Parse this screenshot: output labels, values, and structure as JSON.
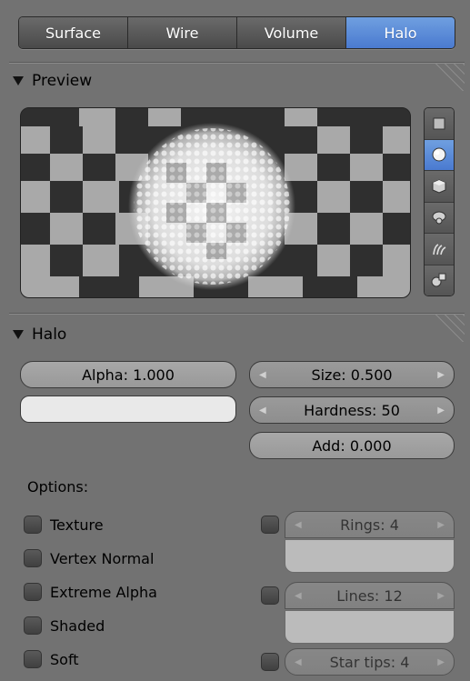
{
  "tabs": [
    {
      "label": "Surface",
      "active": false
    },
    {
      "label": "Wire",
      "active": false
    },
    {
      "label": "Volume",
      "active": false
    },
    {
      "label": "Halo",
      "active": true
    }
  ],
  "preview_panel": {
    "title": "Preview",
    "shape_buttons": [
      {
        "icon": "flat-plane-icon",
        "active": false
      },
      {
        "icon": "sphere-icon",
        "active": true
      },
      {
        "icon": "cube-icon",
        "active": false
      },
      {
        "icon": "monkey-icon",
        "active": false
      },
      {
        "icon": "hair-strands-icon",
        "active": false
      },
      {
        "icon": "sphere-cube-icon",
        "active": false
      }
    ]
  },
  "halo_panel": {
    "title": "Halo",
    "alpha_label": "Alpha: 1.000",
    "size_label": "Size: 0.500",
    "hardness_label": "Hardness: 50",
    "add_label": "Add: 0.000",
    "options_label": "Options:",
    "options": [
      {
        "label": "Texture",
        "checked": false
      },
      {
        "label": "Vertex Normal",
        "checked": false
      },
      {
        "label": "Extreme Alpha",
        "checked": false
      },
      {
        "label": "Shaded",
        "checked": false
      },
      {
        "label": "Soft",
        "checked": false
      }
    ],
    "rings_label": "Rings: 4",
    "lines_label": "Lines: 12",
    "star_tips_label": "Star tips: 4",
    "halo_color": "#e9e9e9",
    "accent_color": "#5a8ae0"
  }
}
